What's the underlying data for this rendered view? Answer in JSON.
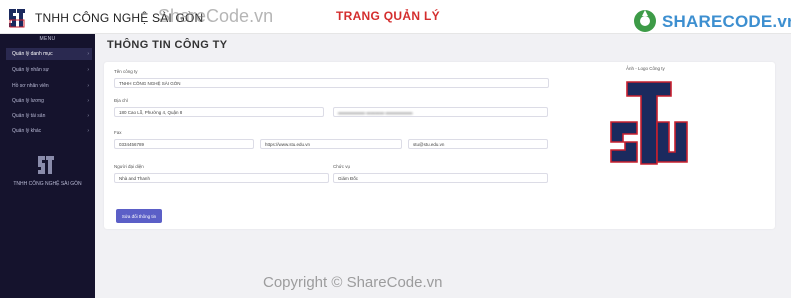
{
  "header": {
    "brand": "TNHH CÔNG NGHỆ SÀI GÒN",
    "admin_title": "TRANG QUẢN LÝ",
    "logo_text": "STU",
    "watermark_logo": "SHARECODE.vn",
    "watermark_top": "ShareCode.vn"
  },
  "sidebar": {
    "title": "MENU",
    "items": [
      {
        "label": "Quản lý danh mục"
      },
      {
        "label": "Quản lý nhân sự"
      },
      {
        "label": "Hồ sơ nhân viên"
      },
      {
        "label": "Quản lý lương"
      },
      {
        "label": "Quản lý tài sản"
      },
      {
        "label": "Quản lý khác"
      }
    ],
    "company": "TNHH CÔNG NGHỆ SÀI GÒN"
  },
  "main": {
    "page_title": "THÔNG TIN CÔNG TY",
    "form": {
      "company_name_label": "Tên công ty",
      "company_name_value": "TNHH CÔNG NGHỆ SÀI GÒN",
      "address_label": "Địa chỉ",
      "address_value": "180 Cao Lỗ, Phường 4, Quận 8",
      "fax_label": "Fax",
      "fax_value": "0334456789",
      "website_value": "https://www.stu.edu.vn",
      "email_value": "stu@stu.edu.vn",
      "representative_label": "Người đại diện",
      "representative_value": "Nhà and Thanh",
      "position_label": "Chức vụ",
      "position_value": "Giám Đốc",
      "logo_label": "Ảnh - Logo Công ty",
      "save_button": "Sửa đổi thông tin"
    }
  },
  "footer": {
    "watermark": "Copyright © ShareCode.vn"
  },
  "colors": {
    "sidebar_bg": "#15132d",
    "accent": "#5b5fc7",
    "admin_title": "#d42e2e",
    "logo_navy": "#1b2a5e",
    "logo_red": "#c8202f"
  }
}
